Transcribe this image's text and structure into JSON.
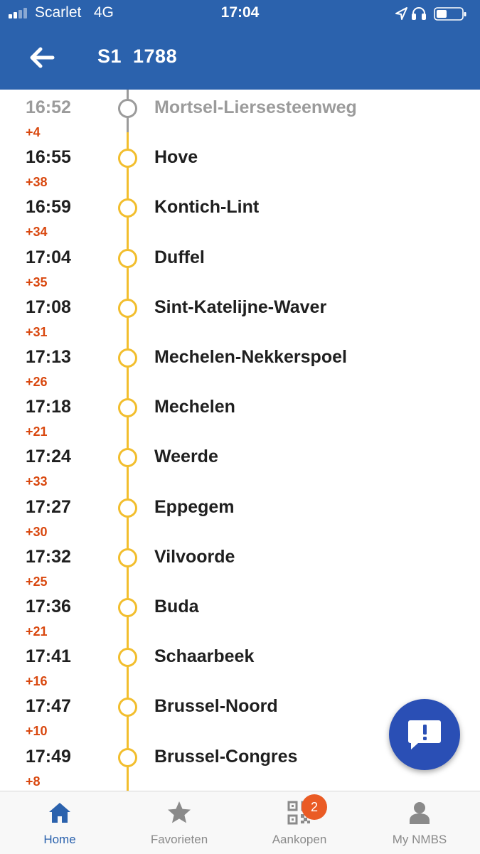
{
  "status_bar": {
    "carrier": "Scarlet",
    "network": "4G",
    "time": "17:04"
  },
  "header": {
    "title": "S1  1788"
  },
  "stops": [
    {
      "time": "16:52",
      "delay": "+4",
      "station": "Mortsel-Liersesteenweg",
      "passed": true
    },
    {
      "time": "16:55",
      "delay": "+38",
      "station": "Hove",
      "passed": false
    },
    {
      "time": "16:59",
      "delay": "+34",
      "station": "Kontich-Lint",
      "passed": false
    },
    {
      "time": "17:04",
      "delay": "+35",
      "station": "Duffel",
      "passed": false
    },
    {
      "time": "17:08",
      "delay": "+31",
      "station": "Sint-Katelijne-Waver",
      "passed": false
    },
    {
      "time": "17:13",
      "delay": "+26",
      "station": "Mechelen-Nekkerspoel",
      "passed": false
    },
    {
      "time": "17:18",
      "delay": "+21",
      "station": "Mechelen",
      "passed": false
    },
    {
      "time": "17:24",
      "delay": "+33",
      "station": "Weerde",
      "passed": false
    },
    {
      "time": "17:27",
      "delay": "+30",
      "station": "Eppegem",
      "passed": false
    },
    {
      "time": "17:32",
      "delay": "+25",
      "station": "Vilvoorde",
      "passed": false
    },
    {
      "time": "17:36",
      "delay": "+21",
      "station": "Buda",
      "passed": false
    },
    {
      "time": "17:41",
      "delay": "+16",
      "station": "Schaarbeek",
      "passed": false
    },
    {
      "time": "17:47",
      "delay": "+10",
      "station": "Brussel-Noord",
      "passed": false
    },
    {
      "time": "17:49",
      "delay": "+8",
      "station": "Brussel-Congres",
      "passed": false
    }
  ],
  "tabs": [
    {
      "label": "Home",
      "icon": "home-icon",
      "active": true
    },
    {
      "label": "Favorieten",
      "icon": "star-icon",
      "active": false
    },
    {
      "label": "Aankopen",
      "icon": "qr-code-icon",
      "active": false,
      "badge": "2"
    },
    {
      "label": "My NMBS",
      "icon": "person-icon",
      "active": false
    }
  ],
  "colors": {
    "header": "#2b62ad",
    "line_upcoming": "#f2be2d",
    "line_passed": "#9b9b9b",
    "delay": "#d9480f",
    "fab": "#2a4fb5",
    "badge": "#ea5b24"
  },
  "fab": {
    "icon": "chat-alert-icon"
  }
}
